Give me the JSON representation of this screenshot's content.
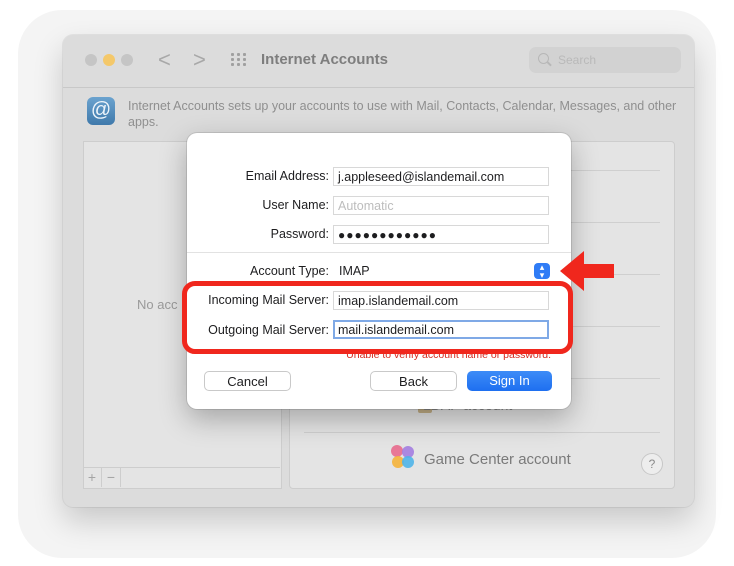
{
  "window": {
    "title": "Internet Accounts",
    "search_placeholder": "Search",
    "nav_back": "<",
    "nav_forward": ">",
    "description": "Internet Accounts sets up your accounts to use with Mail, Contacts, Calendar, Messages, and other apps.",
    "at_symbol": "@"
  },
  "left_pane": {
    "empty_text_fragment": "No acc",
    "plus": "+",
    "minus": "−"
  },
  "right_pane": {
    "ldap_fragment": "LDAP account",
    "game_center_label": "Game Center account",
    "help": "?"
  },
  "dialog": {
    "email": {
      "label": "Email Address:",
      "value": "j.appleseed@islandemail.com"
    },
    "username": {
      "label": "User Name:",
      "placeholder": "Automatic"
    },
    "password": {
      "label": "Password:",
      "value": "●●●●●●●●●●●●"
    },
    "account_type": {
      "label": "Account Type:",
      "value": "IMAP",
      "arrows": "▴\n▾"
    },
    "incoming": {
      "label": "Incoming Mail Server:",
      "value": "imap.islandemail.com"
    },
    "outgoing": {
      "label": "Outgoing Mail Server:",
      "value": "mail.islandemail.com"
    },
    "error": "Unable to verify account name or password.",
    "buttons": {
      "cancel": "Cancel",
      "back": "Back",
      "sign_in": "Sign In"
    }
  },
  "colors": {
    "accent": "#2f7cf6",
    "error": "#d42a1f",
    "annotation": "#f0271d"
  },
  "icons": [
    "search-icon",
    "at-sign-icon",
    "grid-icon",
    "game-center-icon",
    "help-icon",
    "select-arrows-icon",
    "red-arrow-annotation"
  ]
}
